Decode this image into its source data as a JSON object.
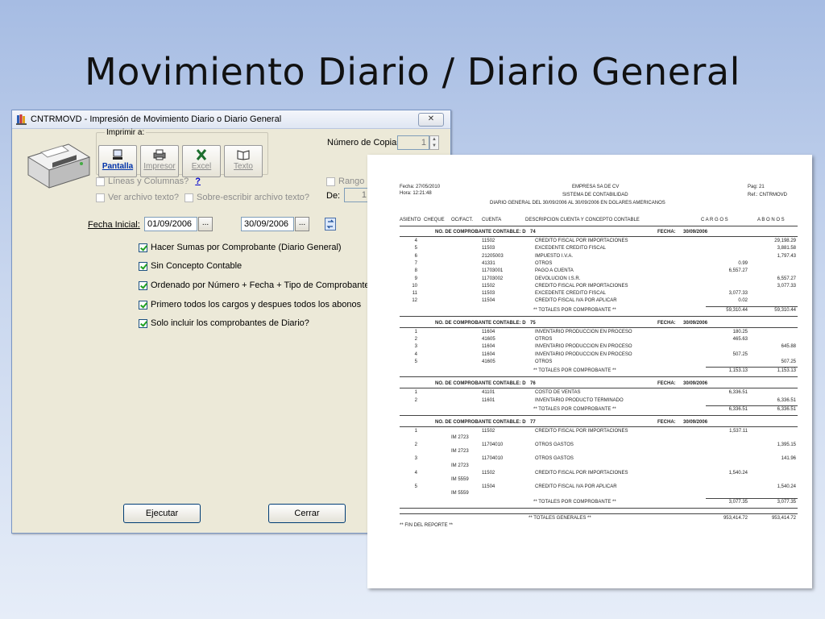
{
  "slide": {
    "title": "Movimiento Diario / Diario General"
  },
  "window": {
    "title": "CNTRMOVD - Impresión de Movimiento Diario  o Diario General",
    "close_symbol": "✕",
    "icon": "app-books-icon"
  },
  "print_group": {
    "legend": "Imprimir a:",
    "buttons": [
      {
        "label": "Pantalla",
        "icon": "screen-icon",
        "state": "active"
      },
      {
        "label": "Impresor",
        "icon": "printer-icon",
        "state": "disabled"
      },
      {
        "label": "Excel",
        "icon": "excel-icon",
        "state": "disabled"
      },
      {
        "label": "Texto",
        "icon": "text-icon",
        "state": "disabled"
      }
    ]
  },
  "copies": {
    "label": "Número de Copias:",
    "value": "1"
  },
  "options_top": {
    "lineas": "Líneas y Columnas?",
    "help": "?",
    "ver_archivo": "Ver archivo texto?",
    "sobre_escribir": "Sobre-escribir archivo texto?",
    "rango": "Rango d",
    "de_label": "De:",
    "de_value": "1"
  },
  "fecha": {
    "label": "Fecha Inicial:",
    "start": "01/09/2006",
    "end": "30/09/2006",
    "dots": "..."
  },
  "checks": [
    "Hacer Sumas por Comprobante (Diario General)",
    "Sin Concepto Contable",
    "Ordenado por Número + Fecha + Tipo de Comprobante",
    "Primero todos los cargos y despues todos los abonos",
    "Solo incluir los comprobantes de Diario?"
  ],
  "buttons": {
    "ejecutar": "Ejecutar",
    "cerrar": "Cerrar"
  },
  "report": {
    "fecha": "Fecha: 27/05/2010",
    "hora": "Hora:  12:21:48",
    "empresa": "EMPRESA SA DE CV",
    "sistema": "SISTEMA DE CONTABILIDAD",
    "titulo": "DIARIO GENERAL  DEL 30/09/2006  AL  30/09/2006  EN  DOLARES AMERICANOS",
    "pag": "Pag:   21",
    "ref": "Ref.:  CNTRMOVD",
    "headers": [
      "ASIENTO",
      "CHEQUE",
      "OC/FACT.",
      "CUENTA",
      "DESCRIPCION CUENTA Y CONCEPTO CONTABLE",
      "C A R G O S",
      "A B O N O S"
    ],
    "comp_label": "NO. DE COMPROBANTE CONTABLE:  D",
    "fecha_label": "FECHA:",
    "totales_label": "** TOTALES POR COMPROBANTE **",
    "sections": [
      {
        "num": "74",
        "date": "30/09/2006",
        "rows": [
          {
            "asiento": "4",
            "ref": "",
            "cuenta": "11502",
            "desc": "CREDITO FISCAL POR IMPORTACIONES",
            "cargo": "",
            "abono": "29,198.29"
          },
          {
            "asiento": "5",
            "ref": "",
            "cuenta": "11503",
            "desc": "EXCEDENTE CREDITO FISCAL",
            "cargo": "",
            "abono": "3,881.58"
          },
          {
            "asiento": "6",
            "ref": "",
            "cuenta": "21205003",
            "desc": "IMPUESTO I.V.A.",
            "cargo": "",
            "abono": "1,797.43"
          },
          {
            "asiento": "7",
            "ref": "",
            "cuenta": "41331",
            "desc": "OTROS",
            "cargo": "0.99",
            "abono": ""
          },
          {
            "asiento": "8",
            "ref": "",
            "cuenta": "11703001",
            "desc": "PAGO A CUENTA",
            "cargo": "6,557.27",
            "abono": ""
          },
          {
            "asiento": "9",
            "ref": "",
            "cuenta": "11703002",
            "desc": "DEVOLUCION I.S.R.",
            "cargo": "",
            "abono": "6,557.27"
          },
          {
            "asiento": "10",
            "ref": "",
            "cuenta": "11502",
            "desc": "CREDITO FISCAL POR IMPORTACIONES",
            "cargo": "",
            "abono": "3,077.33"
          },
          {
            "asiento": "11",
            "ref": "",
            "cuenta": "11503",
            "desc": "EXCEDENTE CREDITO FISCAL",
            "cargo": "3,077.33",
            "abono": ""
          },
          {
            "asiento": "12",
            "ref": "",
            "cuenta": "11504",
            "desc": "CREDITO FISCAL IVA POR APLICAR",
            "cargo": "0.02",
            "abono": ""
          }
        ],
        "total_cargo": "59,310.44",
        "total_abono": "59,310.44"
      },
      {
        "num": "75",
        "date": "30/09/2006",
        "rows": [
          {
            "asiento": "1",
            "ref": "",
            "cuenta": "11604",
            "desc": "INVENTARIO PRODUCCION EN PROCESO",
            "cargo": "180.25",
            "abono": ""
          },
          {
            "asiento": "2",
            "ref": "",
            "cuenta": "41605",
            "desc": "OTROS",
            "cargo": "465.63",
            "abono": ""
          },
          {
            "asiento": "3",
            "ref": "",
            "cuenta": "11604",
            "desc": "INVENTARIO PRODUCCION EN PROCESO",
            "cargo": "",
            "abono": "645.88"
          },
          {
            "asiento": "4",
            "ref": "",
            "cuenta": "11604",
            "desc": "INVENTARIO PRODUCCION EN PROCESO",
            "cargo": "507.25",
            "abono": ""
          },
          {
            "asiento": "5",
            "ref": "",
            "cuenta": "41605",
            "desc": "OTROS",
            "cargo": "",
            "abono": "507.25"
          }
        ],
        "total_cargo": "1,153.13",
        "total_abono": "1,153.13"
      },
      {
        "num": "76",
        "date": "30/09/2006",
        "rows": [
          {
            "asiento": "1",
            "ref": "",
            "cuenta": "41101",
            "desc": "COSTO DE VENTAS",
            "cargo": "6,336.51",
            "abono": ""
          },
          {
            "asiento": "2",
            "ref": "",
            "cuenta": "11601",
            "desc": "INVENTARIO PRODUCTO TERMINADO",
            "cargo": "",
            "abono": "6,336.51"
          }
        ],
        "total_cargo": "6,336.51",
        "total_abono": "6,336.51"
      },
      {
        "num": "77",
        "date": "30/09/2006",
        "rows": [
          {
            "asiento": "1",
            "ref": "IM 2723",
            "cuenta": "11502",
            "desc": "CREDITO FISCAL POR IMPORTACIONES",
            "cargo": "1,537.11",
            "abono": ""
          },
          {
            "asiento": "2",
            "ref": "IM 2723",
            "cuenta": "11704010",
            "desc": "OTROS GASTOS",
            "cargo": "",
            "abono": "1,395.15"
          },
          {
            "asiento": "3",
            "ref": "IM 2723",
            "cuenta": "11704010",
            "desc": "OTROS GASTOS",
            "cargo": "",
            "abono": "141.96"
          },
          {
            "asiento": "4",
            "ref": "IM 5559",
            "cuenta": "11502",
            "desc": "CREDITO FISCAL POR IMPORTACIONES",
            "cargo": "1,540.24",
            "abono": ""
          },
          {
            "asiento": "5",
            "ref": "IM 5559",
            "cuenta": "11504",
            "desc": "CREDITO FISCAL IVA POR APLICAR",
            "cargo": "",
            "abono": "1,540.24"
          }
        ],
        "total_cargo": "3,077.35",
        "total_abono": "3,077.35"
      }
    ],
    "totales_generales_label": "** TOTALES GENERALES **",
    "totales_generales_cargo": "953,414.72",
    "totales_generales_abono": "953,414.72",
    "fin": "** FIN DEL REPORTE **"
  }
}
